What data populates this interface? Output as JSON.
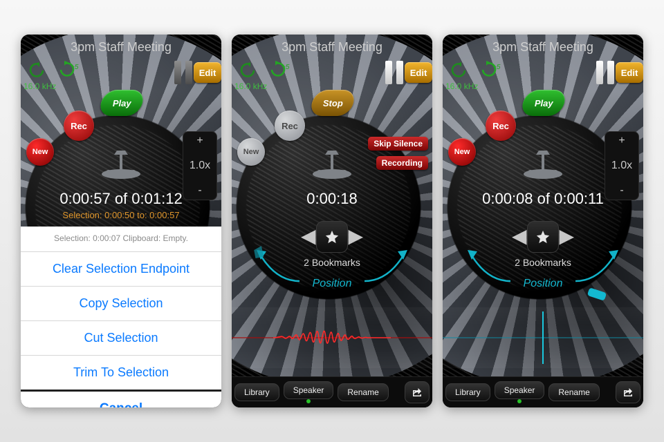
{
  "common": {
    "title": "3pm Staff Meeting",
    "khz": "16.0 kHz",
    "skip5": "+5",
    "speed": {
      "plus": "+",
      "val": "1.0x",
      "minus": "-"
    },
    "edit": "Edit",
    "play_label": "Play",
    "stop_label": "Stop",
    "rec_label": "Rec",
    "new_label": "New",
    "bookmarks": "2 Bookmarks",
    "position_label": "Position",
    "bottom": {
      "library": "Library",
      "speaker": "Speaker",
      "rename": "Rename"
    }
  },
  "p0": {
    "time": "0:00:57 of 0:01:12",
    "selection": "Selection:   0:00:50  to:   0:00:57",
    "sheet_info": "Selection:  0:00:07    Clipboard: Empty.",
    "sheet_items": [
      "Clear Selection Endpoint",
      "Copy Selection",
      "Cut Selection",
      "Trim To Selection"
    ],
    "sheet_cancel": "Cancel"
  },
  "p1": {
    "skip_silence": "Skip Silence",
    "recording": "Recording",
    "time": "0:00:18"
  },
  "p2": {
    "time": "0:00:08 of 0:00:11"
  }
}
